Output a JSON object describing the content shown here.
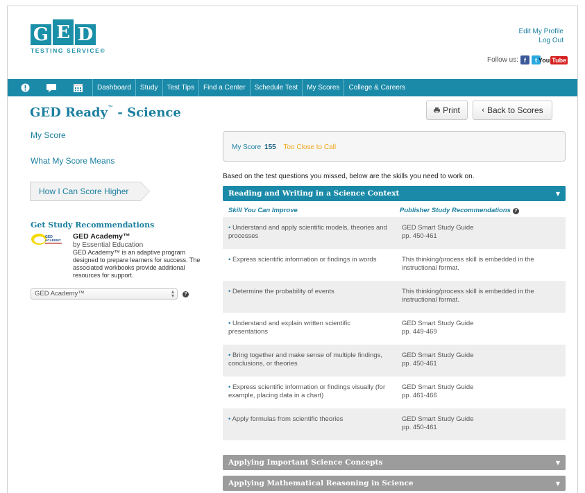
{
  "header": {
    "logo_letters": [
      "G",
      "E",
      "D"
    ],
    "logo_sub": "TESTING SERVICE®",
    "edit_profile": "Edit My Profile",
    "logout": "Log Out",
    "follow_label": "Follow us:",
    "youtube_label_left": "You",
    "youtube_label_right": "Tube"
  },
  "nav": {
    "items": [
      "Dashboard",
      "Study",
      "Test Tips",
      "Find a Center",
      "Schedule Test",
      "My Scores",
      "College & Careers"
    ]
  },
  "page": {
    "title": "GED Ready",
    "title_tm": "™",
    "title_suffix": " - Science",
    "print_label": "Print",
    "back_label": "Back to Scores"
  },
  "sidebar": {
    "links": [
      "My Score",
      "What My Score Means"
    ],
    "active": "How I Can Score Higher",
    "rec_title": "Get Study Recommendations",
    "academy_name": "GED Academy™",
    "academy_by": "by Essential Education",
    "academy_desc": "GED Academy™ is an adaptive program designed to prepare learners for success. The associated workbooks provide additional resources for support.",
    "select_value": "GED Academy™"
  },
  "score": {
    "label": "My Score",
    "value": "155",
    "status": "Too Close to Call",
    "status_color": "#f0a81c"
  },
  "intro": "Based on the test questions you missed, below are the skills you need to work on.",
  "sections": [
    {
      "title": "Reading and Writing in a Science Context",
      "open": true
    },
    {
      "title": "Applying Important Science Concepts",
      "open": false
    },
    {
      "title": "Applying Mathematical Reasoning in Science",
      "open": false
    }
  ],
  "table": {
    "col1": "Skill You Can Improve",
    "col2": "Publisher Study Recommendations",
    "rows": [
      {
        "skill": "Understand and apply scientific models, theories and processes",
        "rec": "GED Smart Study Guide\npp. 450-461"
      },
      {
        "skill": "Express scientific information or findings in words",
        "rec": "This thinking/process skill is embedded in the instructional format."
      },
      {
        "skill": "Determine the probability of events",
        "rec": "This thinking/process skill is embedded in the instructional format."
      },
      {
        "skill": "Understand and explain written scientific presentations",
        "rec": "GED Smart Study Guide\npp. 449-469"
      },
      {
        "skill": "Bring together and make sense of multiple findings, conclusions, or theories",
        "rec": "GED Smart Study Guide\npp. 450-461"
      },
      {
        "skill": "Express scientific information or findings visually (for example, placing data in a chart)",
        "rec": "GED Smart Study Guide\npp. 461-466"
      },
      {
        "skill": "Apply formulas from scientific theories",
        "rec": "GED Smart Study Guide\npp. 450-461"
      }
    ]
  },
  "colors": {
    "brand": "#1b8aa9",
    "link": "#1a7fa0",
    "collapsed": "#9c9c9c"
  }
}
